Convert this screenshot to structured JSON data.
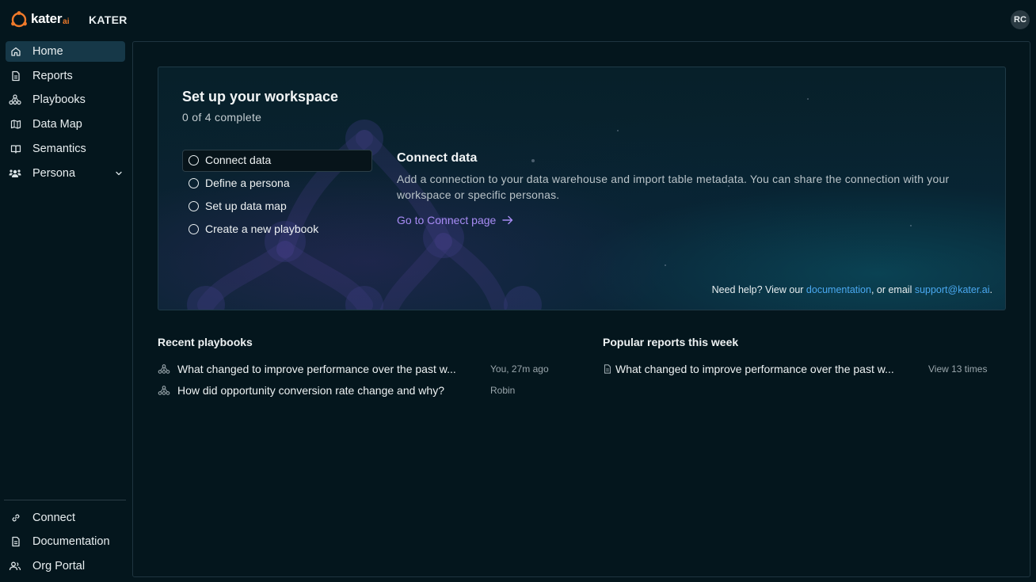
{
  "app": {
    "logo_text": "kater",
    "logo_suffix": "ai",
    "org_name": "KATER",
    "user_initials": "RC"
  },
  "sidebar": {
    "items": [
      {
        "label": "Home",
        "icon": "home-icon",
        "active": true
      },
      {
        "label": "Reports",
        "icon": "report-icon"
      },
      {
        "label": "Playbooks",
        "icon": "playbook-icon"
      },
      {
        "label": "Data Map",
        "icon": "map-icon"
      },
      {
        "label": "Semantics",
        "icon": "book-icon"
      },
      {
        "label": "Persona",
        "icon": "persona-icon",
        "expandable": true
      }
    ],
    "bottom_items": [
      {
        "label": "Connect",
        "icon": "link-icon"
      },
      {
        "label": "Documentation",
        "icon": "document-icon"
      },
      {
        "label": "Org Portal",
        "icon": "users-icon"
      }
    ]
  },
  "setup": {
    "title": "Set up your workspace",
    "progress": "0 of 4 complete",
    "steps": [
      {
        "label": "Connect data",
        "active": true
      },
      {
        "label": "Define a persona"
      },
      {
        "label": "Set up data map"
      },
      {
        "label": "Create a new playbook"
      }
    ],
    "detail": {
      "title": "Connect data",
      "description": "Add a connection to your data warehouse and import table metadata. You can share the connection with your workspace or specific personas.",
      "link": "Go to Connect page"
    },
    "help": {
      "prefix": "Need help? View our ",
      "doc_link": "documentation",
      "middle": ", or email ",
      "email_link": "support@kater.ai",
      "suffix": "."
    }
  },
  "recent_playbooks": {
    "title": "Recent playbooks",
    "items": [
      {
        "title": "What changed to improve performance over the past w...",
        "meta": "You, 27m ago"
      },
      {
        "title": "How did opportunity conversion rate change and why?",
        "meta": "Robin"
      }
    ]
  },
  "popular_reports": {
    "title": "Popular reports this week",
    "items": [
      {
        "title": "What changed to improve performance over the past w...",
        "meta": "View 13 times"
      }
    ]
  },
  "colors": {
    "background": "#04161d",
    "active_nav": "#163848",
    "link_purple": "#a88cf5",
    "link_blue": "#4aa8f0",
    "brand_orange": "#f07a2a"
  }
}
